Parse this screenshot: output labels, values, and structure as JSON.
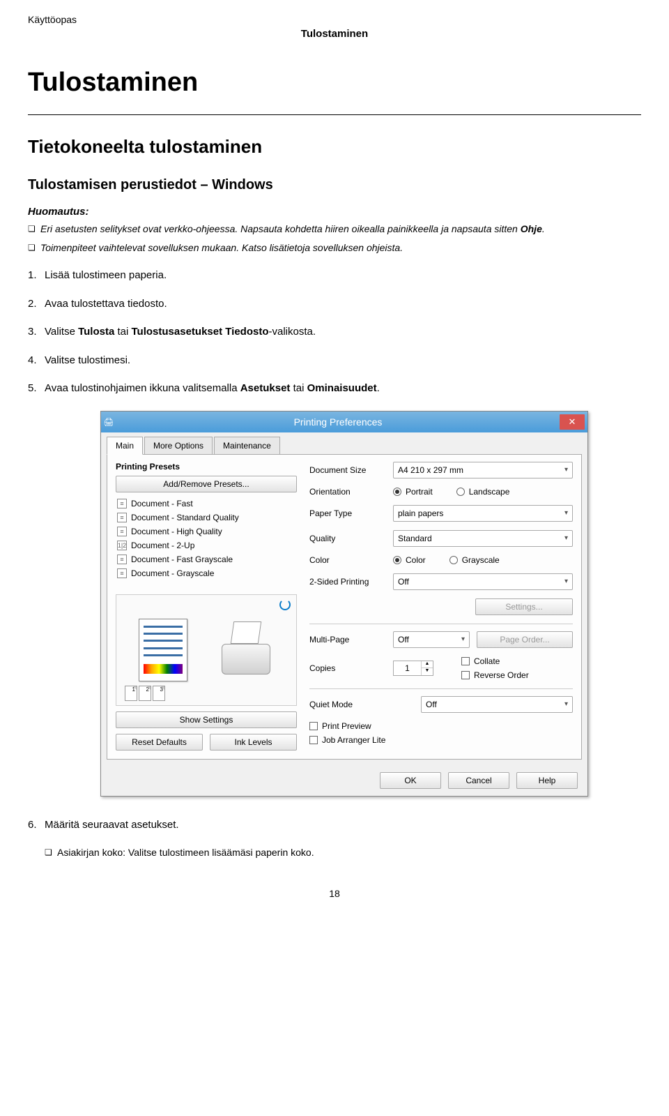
{
  "header": {
    "manual": "Käyttöopas",
    "section": "Tulostaminen"
  },
  "headings": {
    "h1": "Tulostaminen",
    "h2": "Tietokoneelta tulostaminen",
    "h3": "Tulostamisen perustiedot – Windows"
  },
  "note": {
    "label": "Huomautus:",
    "items": [
      "Eri asetusten selitykset ovat verkko-ohjeessa. Napsauta kohdetta hiiren oikealla painikkeella ja napsauta sitten <b>Ohje</b>.",
      "Toimenpiteet vaihtelevat sovelluksen mukaan. Katso lisätietoja sovelluksen ohjeista."
    ]
  },
  "steps": [
    "Lisää tulostimeen paperia.",
    "Avaa tulostettava tiedosto.",
    "Valitse <b>Tulosta</b> tai <b>Tulostusasetukset Tiedosto</b>-valikosta.",
    "Valitse tulostimesi.",
    "Avaa tulostinohjaimen ikkuna valitsemalla <b>Asetukset</b> tai <b>Ominaisuudet</b>."
  ],
  "dialog": {
    "title": "Printing Preferences",
    "tabs": [
      "Main",
      "More Options",
      "Maintenance"
    ],
    "presets_label": "Printing Presets",
    "add_remove": "Add/Remove Presets...",
    "presets": [
      "Document - Fast",
      "Document - Standard Quality",
      "Document - High Quality",
      "Document - 2-Up",
      "Document - Fast Grayscale",
      "Document - Grayscale"
    ],
    "fields": {
      "doc_size": {
        "label": "Document Size",
        "value": "A4 210 x 297 mm"
      },
      "orientation": {
        "label": "Orientation",
        "opts": [
          "Portrait",
          "Landscape"
        ],
        "selected": "Portrait"
      },
      "paper_type": {
        "label": "Paper Type",
        "value": "plain papers"
      },
      "quality": {
        "label": "Quality",
        "value": "Standard"
      },
      "color": {
        "label": "Color",
        "opts": [
          "Color",
          "Grayscale"
        ],
        "selected": "Color"
      },
      "two_sided": {
        "label": "2-Sided Printing",
        "value": "Off"
      },
      "settings_btn": "Settings...",
      "multi_page": {
        "label": "Multi-Page",
        "value": "Off"
      },
      "page_order_btn": "Page Order...",
      "copies": {
        "label": "Copies",
        "value": "1"
      },
      "collate": "Collate",
      "reverse": "Reverse Order",
      "quiet": {
        "label": "Quiet Mode",
        "value": "Off"
      },
      "print_preview": "Print Preview",
      "job_arranger": "Job Arranger Lite"
    },
    "bottom_left": {
      "show": "Show Settings",
      "reset": "Reset Defaults",
      "ink": "Ink Levels"
    },
    "footer": [
      "OK",
      "Cancel",
      "Help"
    ]
  },
  "after": {
    "step6": "Määritä seuraavat asetukset.",
    "bullet6": "Asiakirjan koko: Valitse tulostimeen lisäämäsi paperin koko."
  },
  "page_number": "18"
}
